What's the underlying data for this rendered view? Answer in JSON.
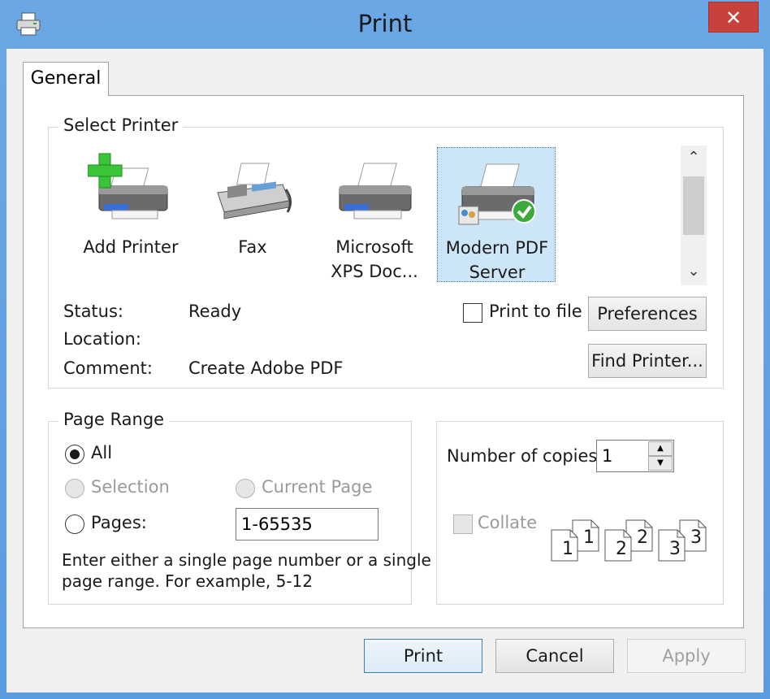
{
  "window": {
    "title": "Print",
    "close_glyph": "✕"
  },
  "tabs": [
    {
      "label": "General"
    }
  ],
  "select_printer": {
    "legend": "Select Printer",
    "printers": [
      {
        "name_line1": "Add Printer",
        "name_line2": "",
        "icon": "add-printer-icon"
      },
      {
        "name_line1": "Fax",
        "name_line2": "",
        "icon": "fax-icon"
      },
      {
        "name_line1": "Microsoft",
        "name_line2": "XPS Doc...",
        "icon": "printer-icon"
      },
      {
        "name_line1": "Modern PDF",
        "name_line2": "Server",
        "icon": "pdf-printer-default-icon",
        "selected": true
      }
    ],
    "status_label": "Status:",
    "status_value": "Ready",
    "location_label": "Location:",
    "location_value": "",
    "comment_label": "Comment:",
    "comment_value": "Create Adobe PDF",
    "print_to_file_label": "Print to file",
    "print_to_file_checked": false,
    "preferences_label": "Preferences",
    "find_printer_label": "Find Printer..."
  },
  "page_range": {
    "legend": "Page Range",
    "all_label": "All",
    "selection_label": "Selection",
    "current_page_label": "Current Page",
    "pages_label": "Pages:",
    "pages_value": "1-65535",
    "hint_line1": "Enter either a single page number or a single",
    "hint_line2": "page range.  For example, 5-12",
    "selected": "All"
  },
  "copies": {
    "number_label": "Number of copies:",
    "number_value": "1",
    "collate_label": "Collate",
    "collate_checked": false,
    "collate_pages": [
      "1",
      "1",
      "2",
      "2",
      "3",
      "3"
    ]
  },
  "footer": {
    "print_label": "Print",
    "cancel_label": "Cancel",
    "apply_label": "Apply"
  },
  "colors": {
    "titlebar": "#5b9be0",
    "close": "#c7423a",
    "selection": "#cde6f7",
    "default_button_border": "#3c7fb1"
  }
}
